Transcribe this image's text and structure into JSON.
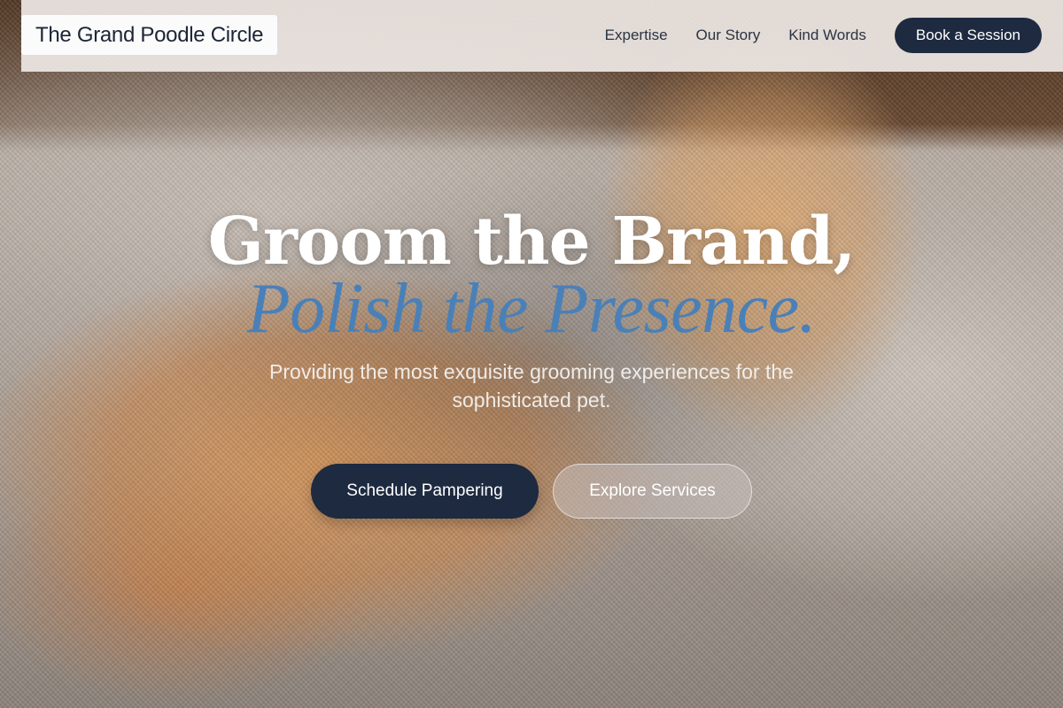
{
  "brand": {
    "name": "The Grand Poodle Circle"
  },
  "nav": {
    "links": [
      "Expertise",
      "Our Story",
      "Kind Words"
    ],
    "cta": "Book a Session"
  },
  "hero": {
    "headline_line1": "Groom the Brand,",
    "headline_line2": "Polish the Presence.",
    "subtitle": "Providing the most exquisite grooming experiences for the sophisticated pet.",
    "primary_cta": "Schedule Pampering",
    "secondary_cta": "Explore Services",
    "background_image": "orange-tabby-cat-on-couch"
  },
  "colors": {
    "navy": "#1d2a40",
    "accent_blue": "#4a80b8",
    "header_bg": "#eee8e5"
  }
}
